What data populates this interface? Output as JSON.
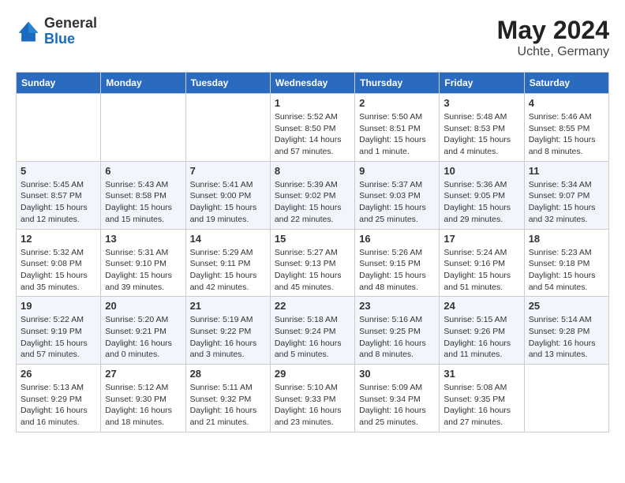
{
  "header": {
    "logo_general": "General",
    "logo_blue": "Blue",
    "month_year": "May 2024",
    "location": "Uchte, Germany"
  },
  "days_of_week": [
    "Sunday",
    "Monday",
    "Tuesday",
    "Wednesday",
    "Thursday",
    "Friday",
    "Saturday"
  ],
  "weeks": [
    [
      {
        "day": "",
        "info": ""
      },
      {
        "day": "",
        "info": ""
      },
      {
        "day": "",
        "info": ""
      },
      {
        "day": "1",
        "info": "Sunrise: 5:52 AM\nSunset: 8:50 PM\nDaylight: 14 hours and 57 minutes."
      },
      {
        "day": "2",
        "info": "Sunrise: 5:50 AM\nSunset: 8:51 PM\nDaylight: 15 hours and 1 minute."
      },
      {
        "day": "3",
        "info": "Sunrise: 5:48 AM\nSunset: 8:53 PM\nDaylight: 15 hours and 4 minutes."
      },
      {
        "day": "4",
        "info": "Sunrise: 5:46 AM\nSunset: 8:55 PM\nDaylight: 15 hours and 8 minutes."
      }
    ],
    [
      {
        "day": "5",
        "info": "Sunrise: 5:45 AM\nSunset: 8:57 PM\nDaylight: 15 hours and 12 minutes."
      },
      {
        "day": "6",
        "info": "Sunrise: 5:43 AM\nSunset: 8:58 PM\nDaylight: 15 hours and 15 minutes."
      },
      {
        "day": "7",
        "info": "Sunrise: 5:41 AM\nSunset: 9:00 PM\nDaylight: 15 hours and 19 minutes."
      },
      {
        "day": "8",
        "info": "Sunrise: 5:39 AM\nSunset: 9:02 PM\nDaylight: 15 hours and 22 minutes."
      },
      {
        "day": "9",
        "info": "Sunrise: 5:37 AM\nSunset: 9:03 PM\nDaylight: 15 hours and 25 minutes."
      },
      {
        "day": "10",
        "info": "Sunrise: 5:36 AM\nSunset: 9:05 PM\nDaylight: 15 hours and 29 minutes."
      },
      {
        "day": "11",
        "info": "Sunrise: 5:34 AM\nSunset: 9:07 PM\nDaylight: 15 hours and 32 minutes."
      }
    ],
    [
      {
        "day": "12",
        "info": "Sunrise: 5:32 AM\nSunset: 9:08 PM\nDaylight: 15 hours and 35 minutes."
      },
      {
        "day": "13",
        "info": "Sunrise: 5:31 AM\nSunset: 9:10 PM\nDaylight: 15 hours and 39 minutes."
      },
      {
        "day": "14",
        "info": "Sunrise: 5:29 AM\nSunset: 9:11 PM\nDaylight: 15 hours and 42 minutes."
      },
      {
        "day": "15",
        "info": "Sunrise: 5:27 AM\nSunset: 9:13 PM\nDaylight: 15 hours and 45 minutes."
      },
      {
        "day": "16",
        "info": "Sunrise: 5:26 AM\nSunset: 9:15 PM\nDaylight: 15 hours and 48 minutes."
      },
      {
        "day": "17",
        "info": "Sunrise: 5:24 AM\nSunset: 9:16 PM\nDaylight: 15 hours and 51 minutes."
      },
      {
        "day": "18",
        "info": "Sunrise: 5:23 AM\nSunset: 9:18 PM\nDaylight: 15 hours and 54 minutes."
      }
    ],
    [
      {
        "day": "19",
        "info": "Sunrise: 5:22 AM\nSunset: 9:19 PM\nDaylight: 15 hours and 57 minutes."
      },
      {
        "day": "20",
        "info": "Sunrise: 5:20 AM\nSunset: 9:21 PM\nDaylight: 16 hours and 0 minutes."
      },
      {
        "day": "21",
        "info": "Sunrise: 5:19 AM\nSunset: 9:22 PM\nDaylight: 16 hours and 3 minutes."
      },
      {
        "day": "22",
        "info": "Sunrise: 5:18 AM\nSunset: 9:24 PM\nDaylight: 16 hours and 5 minutes."
      },
      {
        "day": "23",
        "info": "Sunrise: 5:16 AM\nSunset: 9:25 PM\nDaylight: 16 hours and 8 minutes."
      },
      {
        "day": "24",
        "info": "Sunrise: 5:15 AM\nSunset: 9:26 PM\nDaylight: 16 hours and 11 minutes."
      },
      {
        "day": "25",
        "info": "Sunrise: 5:14 AM\nSunset: 9:28 PM\nDaylight: 16 hours and 13 minutes."
      }
    ],
    [
      {
        "day": "26",
        "info": "Sunrise: 5:13 AM\nSunset: 9:29 PM\nDaylight: 16 hours and 16 minutes."
      },
      {
        "day": "27",
        "info": "Sunrise: 5:12 AM\nSunset: 9:30 PM\nDaylight: 16 hours and 18 minutes."
      },
      {
        "day": "28",
        "info": "Sunrise: 5:11 AM\nSunset: 9:32 PM\nDaylight: 16 hours and 21 minutes."
      },
      {
        "day": "29",
        "info": "Sunrise: 5:10 AM\nSunset: 9:33 PM\nDaylight: 16 hours and 23 minutes."
      },
      {
        "day": "30",
        "info": "Sunrise: 5:09 AM\nSunset: 9:34 PM\nDaylight: 16 hours and 25 minutes."
      },
      {
        "day": "31",
        "info": "Sunrise: 5:08 AM\nSunset: 9:35 PM\nDaylight: 16 hours and 27 minutes."
      },
      {
        "day": "",
        "info": ""
      }
    ]
  ]
}
